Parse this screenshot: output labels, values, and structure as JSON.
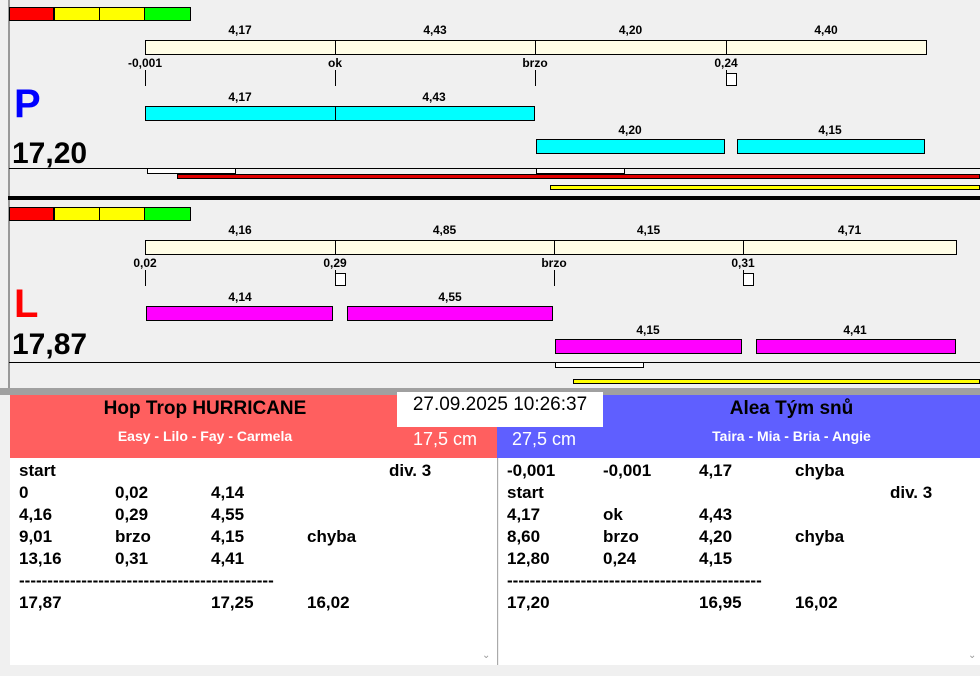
{
  "colors": {
    "red_team": "#ff5f5f",
    "blue_team": "#5f5fff",
    "cyan": "#00ffff",
    "magenta": "#ff00ff",
    "scale": "#fffde6"
  },
  "top": {
    "letter": "P",
    "score": "17,20",
    "scale_labels": [
      "4,17",
      "4,43",
      "4,20",
      "4,40"
    ],
    "tick_labels": [
      "-0,001",
      "ok",
      "brzo",
      "0,24"
    ],
    "row1_labels": [
      "4,17",
      "4,43"
    ],
    "row2_labels": [
      "4,20",
      "4,15"
    ]
  },
  "bottom": {
    "letter": "L",
    "score": "17,87",
    "scale_labels": [
      "4,16",
      "4,85",
      "4,15",
      "4,71"
    ],
    "tick_labels": [
      "0,02",
      "0,29",
      "brzo",
      "0,31"
    ],
    "row1_labels": [
      "4,14",
      "4,55"
    ],
    "row2_labels": [
      "4,15",
      "4,41"
    ]
  },
  "datetime": "27.09.2025 10:26:37",
  "left_team": {
    "name": "Hop Trop HURRICANE",
    "members": "Easy - Lilo - Fay - Carmela",
    "height": "17,5 cm",
    "rows": [
      [
        "start",
        "",
        "",
        "",
        "div.  3"
      ],
      [
        "0",
        "0,02",
        "4,14",
        "",
        ""
      ],
      [
        "4,16",
        "0,29",
        "4,55",
        "",
        ""
      ],
      [
        "9,01",
        "brzo",
        "4,15",
        "chyba",
        ""
      ],
      [
        "13,16",
        "0,31",
        "4,41",
        "",
        ""
      ],
      [
        "---------------------------------------------",
        "",
        "",
        "",
        ""
      ],
      [
        "17,87",
        "",
        "17,25",
        "16,02",
        ""
      ]
    ]
  },
  "right_team": {
    "name": "Alea Tým snů",
    "members": "Taira - Mia - Bria - Angie",
    "height": "27,5 cm",
    "rows": [
      [
        "-0,001",
        "-0,001",
        "4,17",
        "chyba",
        ""
      ],
      [
        "start",
        "",
        "",
        "",
        "div.  3"
      ],
      [
        "4,17",
        "ok",
        "4,43",
        "",
        ""
      ],
      [
        "8,60",
        "brzo",
        "4,20",
        "chyba",
        ""
      ],
      [
        "12,80",
        "0,24",
        "4,15",
        "",
        ""
      ],
      [
        "---------------------------------------------",
        "",
        "",
        "",
        ""
      ],
      [
        "17,20",
        "",
        "16,95",
        "16,02",
        ""
      ]
    ]
  }
}
